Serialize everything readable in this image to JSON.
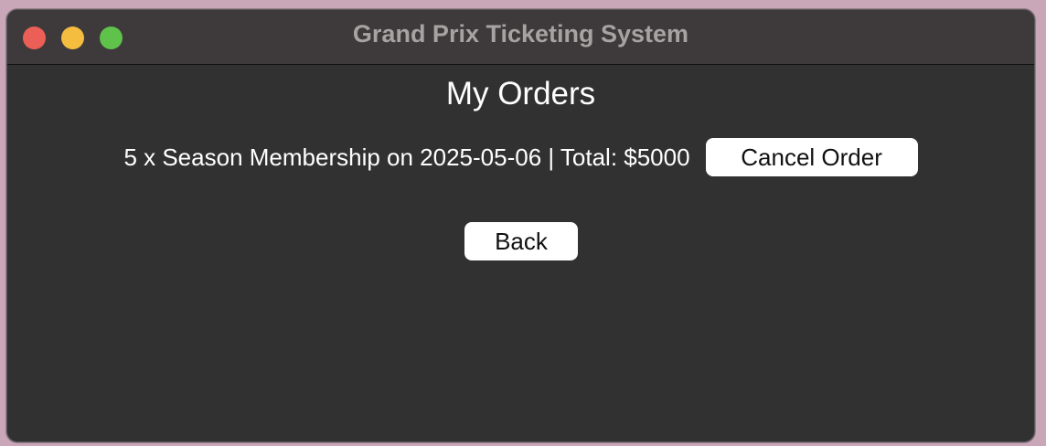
{
  "window": {
    "title": "Grand Prix Ticketing System"
  },
  "page": {
    "heading": "My Orders"
  },
  "orders": [
    {
      "summary": "5 x Season Membership on 2025-05-06 | Total: $5000",
      "cancel_label": "Cancel Order"
    }
  ],
  "actions": {
    "back_label": "Back"
  },
  "colors": {
    "close": "#ec5f57",
    "minimize": "#f4bd3f",
    "zoom": "#5ec24b",
    "window_bg": "#313131",
    "titlebar_bg": "#3e3a3b"
  }
}
